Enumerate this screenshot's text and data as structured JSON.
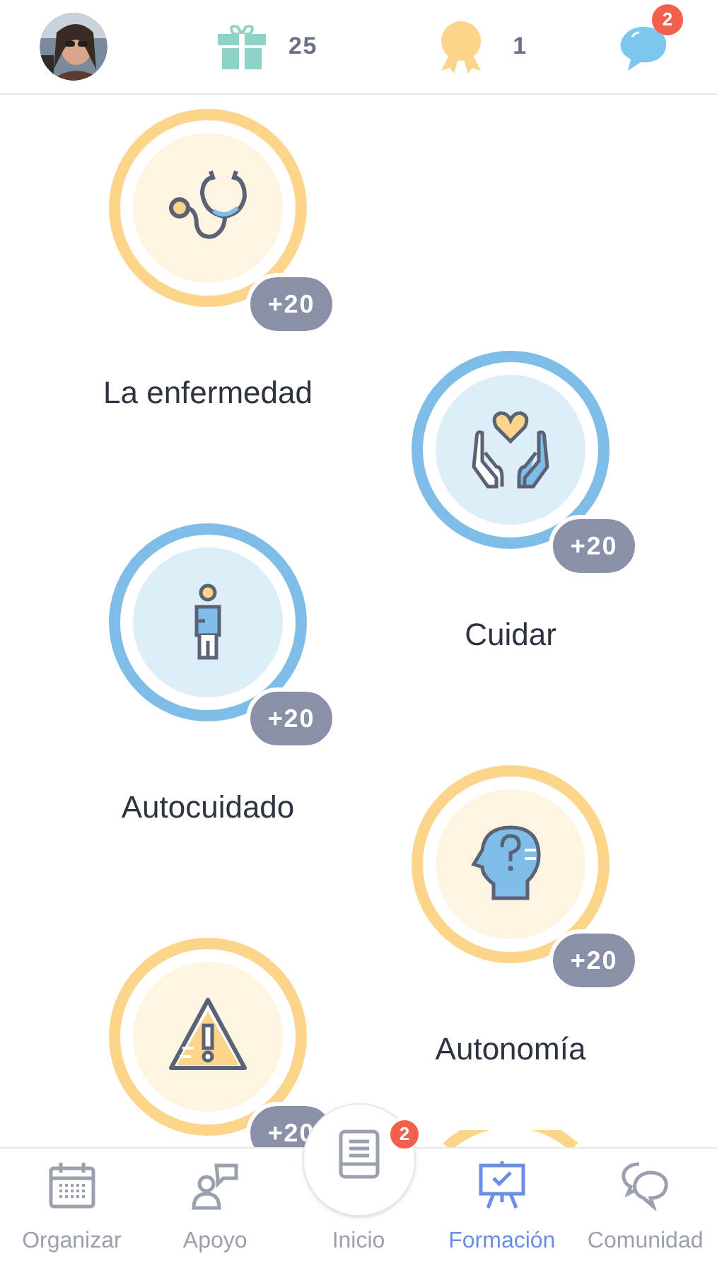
{
  "header": {
    "gifts": "25",
    "medals": "1",
    "messages_badge": "2"
  },
  "modules": [
    {
      "title": "La enfermedad",
      "points": "+20",
      "color": "#fcd58a"
    },
    {
      "title": "Cuidar",
      "points": "+20",
      "color": "#7dbde8"
    },
    {
      "title": "Autocuidado",
      "points": "+20",
      "color": "#7dbde8"
    },
    {
      "title": "Autonomía",
      "points": "+20",
      "color": "#fcd58a"
    },
    {
      "points": "+20",
      "color": "#fcd58a"
    },
    {
      "color": "#fcd58a"
    }
  ],
  "tab_bar": [
    {
      "label": "Organizar",
      "selected": false
    },
    {
      "label": "Apoyo",
      "selected": false
    },
    {
      "label": "Inicio",
      "selected": false,
      "badge": "2"
    },
    {
      "label": "Formación",
      "selected": true
    },
    {
      "label": "Comunidad",
      "selected": false
    }
  ]
}
